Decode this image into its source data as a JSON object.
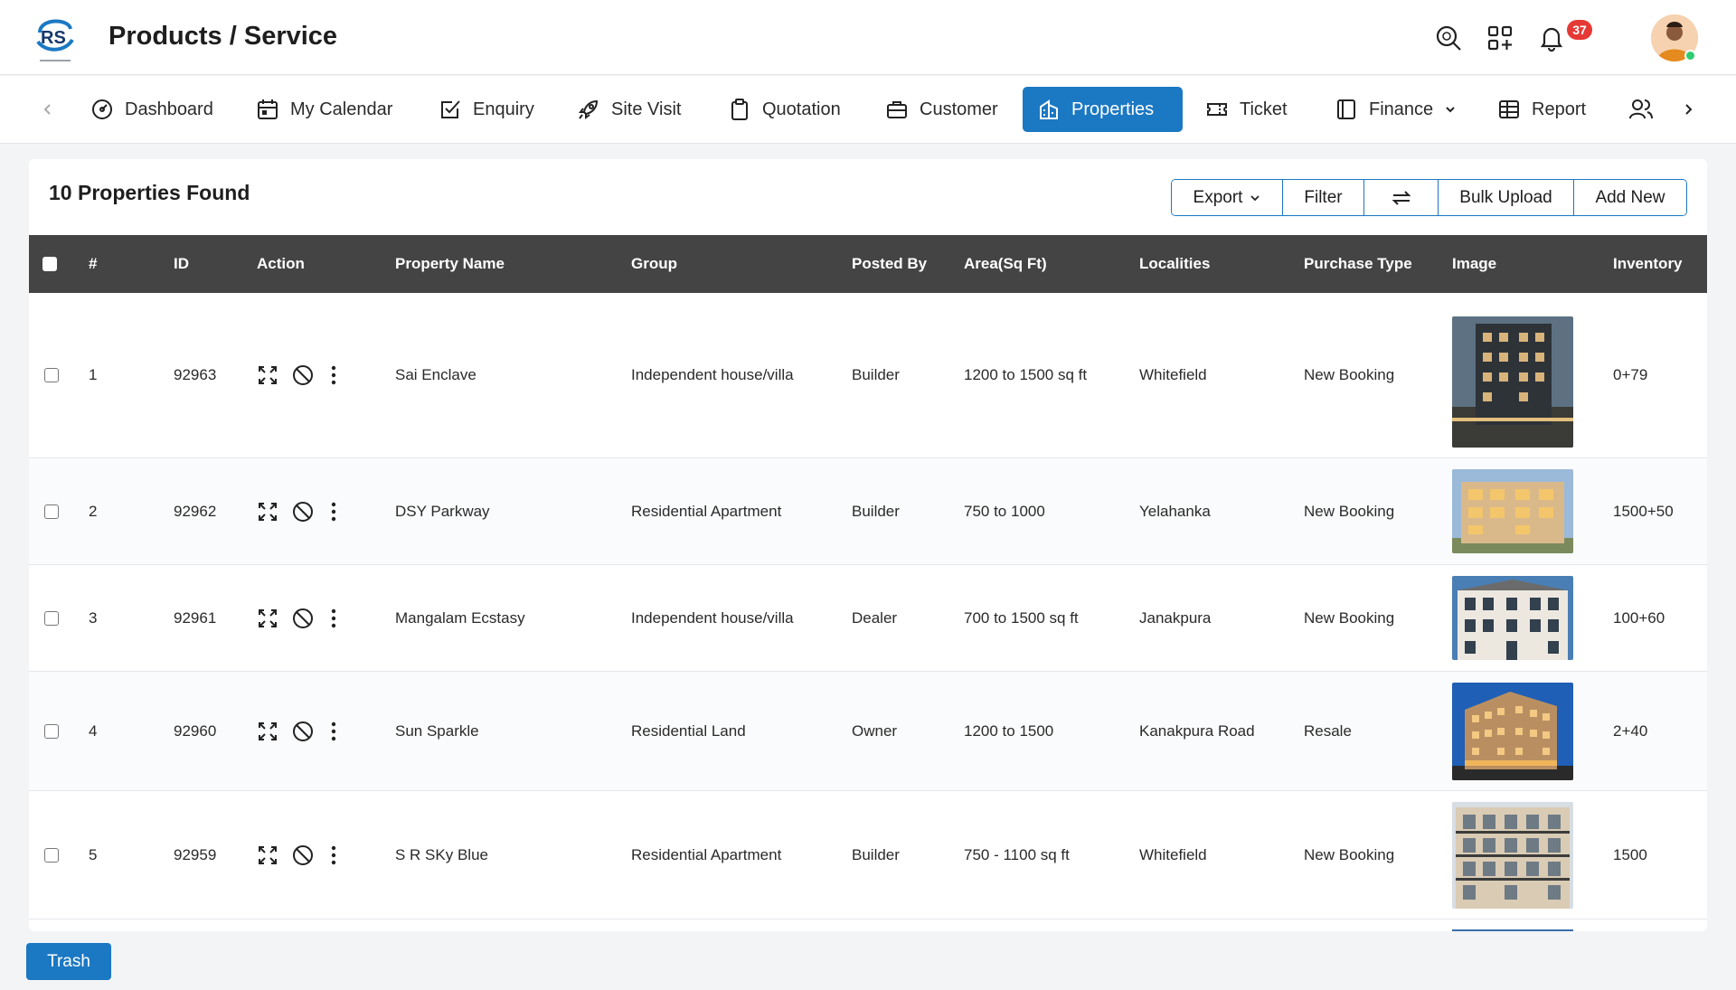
{
  "header": {
    "title": "Products / Service",
    "notification_count": "37",
    "icons": [
      "search-icon",
      "apps-icon",
      "bell-icon"
    ]
  },
  "nav": {
    "items": [
      {
        "label": "Dashboard",
        "icon": "dashboard-icon"
      },
      {
        "label": "My Calendar",
        "icon": "calendar-icon"
      },
      {
        "label": "Enquiry",
        "icon": "checkbox-icon"
      },
      {
        "label": "Site Visit",
        "icon": "rocket-icon"
      },
      {
        "label": "Quotation",
        "icon": "clipboard-icon"
      },
      {
        "label": "Customer",
        "icon": "briefcase-icon"
      },
      {
        "label": "Properties",
        "icon": "building-icon",
        "active": true
      },
      {
        "label": "Ticket",
        "icon": "ticket-icon"
      },
      {
        "label": "Finance",
        "icon": "book-icon",
        "dropdown": true
      },
      {
        "label": "Report",
        "icon": "table-icon"
      },
      {
        "label": "",
        "icon": "users-icon"
      }
    ]
  },
  "content": {
    "found_label": "10 Properties Found",
    "toolbar": {
      "export": "Export",
      "filter": "Filter",
      "bulk_upload": "Bulk Upload",
      "add_new": "Add New"
    },
    "columns": [
      "#",
      "ID",
      "Action",
      "Property Name",
      "Group",
      "Posted By",
      "Area(Sq Ft)",
      "Localities",
      "Purchase Type",
      "Image",
      "Inventory"
    ],
    "rows": [
      {
        "num": "1",
        "id": "92963",
        "name": "Sai Enclave",
        "group": "Independent house/villa",
        "posted_by": "Builder",
        "area": "1200 to 1500 sq ft",
        "locality": "Whitefield",
        "purchase_type": "New Booking",
        "inventory": "0+79"
      },
      {
        "num": "2",
        "id": "92962",
        "name": "DSY Parkway",
        "group": "Residential Apartment",
        "posted_by": "Builder",
        "area": "750 to 1000",
        "locality": "Yelahanka",
        "purchase_type": "New Booking",
        "inventory": "1500+50"
      },
      {
        "num": "3",
        "id": "92961",
        "name": "Mangalam Ecstasy",
        "group": "Independent house/villa",
        "posted_by": "Dealer",
        "area": "700 to 1500 sq ft",
        "locality": "Janakpura",
        "purchase_type": "New Booking",
        "inventory": "100+60"
      },
      {
        "num": "4",
        "id": "92960",
        "name": "Sun Sparkle",
        "group": "Residential Land",
        "posted_by": "Owner",
        "area": "1200 to 1500",
        "locality": "Kanakpura Road",
        "purchase_type": "Resale",
        "inventory": "2+40"
      },
      {
        "num": "5",
        "id": "92959",
        "name": "S R SKy Blue",
        "group": "Residential Apartment",
        "posted_by": "Builder",
        "area": "750 - 1100 sq ft",
        "locality": "Whitefield",
        "purchase_type": "New Booking",
        "inventory": "1500"
      }
    ]
  },
  "footer": {
    "trash": "Trash"
  },
  "colors": {
    "primary": "#1b78c3",
    "table_header": "#444444",
    "badge": "#e53935"
  }
}
